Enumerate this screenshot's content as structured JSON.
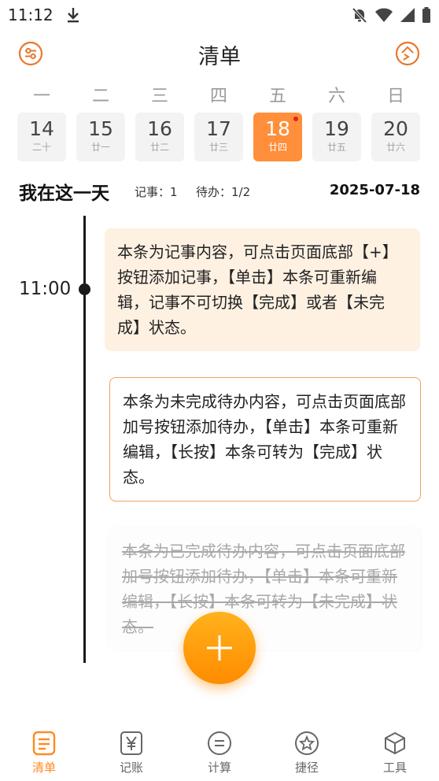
{
  "status_bar": {
    "time": "11:12"
  },
  "header": {
    "title": "清单"
  },
  "week": {
    "weekdays": [
      "一",
      "二",
      "三",
      "四",
      "五",
      "六",
      "日"
    ],
    "dates": [
      {
        "day": "14",
        "lunar": "二十"
      },
      {
        "day": "15",
        "lunar": "廿一"
      },
      {
        "day": "16",
        "lunar": "廿二"
      },
      {
        "day": "17",
        "lunar": "廿三"
      },
      {
        "day": "18",
        "lunar": "廿四"
      },
      {
        "day": "19",
        "lunar": "廿五"
      },
      {
        "day": "20",
        "lunar": "廿六"
      }
    ],
    "selected_index": 4
  },
  "summary": {
    "title": "我在这一天",
    "notes_count": "记事：1",
    "todo_count": "待办：1/2",
    "date": "2025-07-18"
  },
  "timeline": {
    "time": "11:00",
    "note_card": "本条为记事内容，可点击页面底部【+】按钮添加记事，【单击】本条可重新编辑，记事不可切换【完成】或者【未完成】状态。",
    "todo_card": "本条为未完成待办内容，可点击页面底部加号按钮添加待办，【单击】本条可重新编辑，【长按】本条可转为【完成】状态。",
    "done_card": "本条为已完成待办内容，可点击页面底部加号按钮添加待办，【单击】本条可重新编辑，【长按】本条可转为【未完成】状态。"
  },
  "bottom_nav": {
    "items": [
      {
        "label": "清单",
        "icon": "list-icon",
        "active": true
      },
      {
        "label": "记账",
        "icon": "yen-icon",
        "active": false
      },
      {
        "label": "计算",
        "icon": "equals-icon",
        "active": false
      },
      {
        "label": "捷径",
        "icon": "star-icon",
        "active": false
      },
      {
        "label": "工具",
        "icon": "cube-icon",
        "active": false
      }
    ]
  },
  "colors": {
    "accent": "#ff8f3a",
    "note_bg": "#fef1e2",
    "todo_border": "#f0a35e",
    "done_text": "#a8a8a8"
  }
}
